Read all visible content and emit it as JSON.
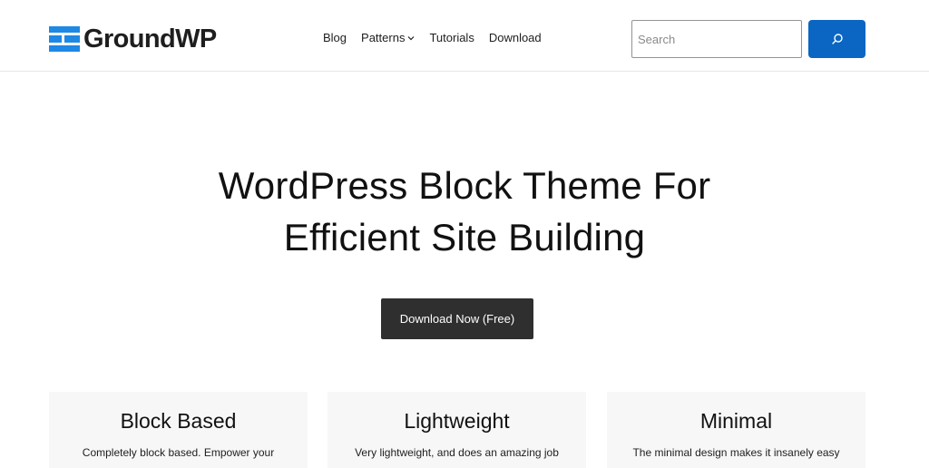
{
  "header": {
    "logo_text": "GroundWP",
    "nav": [
      {
        "label": "Blog",
        "has_dropdown": false
      },
      {
        "label": "Patterns",
        "has_dropdown": true
      },
      {
        "label": "Tutorials",
        "has_dropdown": false
      },
      {
        "label": "Download",
        "has_dropdown": false
      }
    ],
    "search": {
      "placeholder": "Search",
      "value": "",
      "button_icon": "search-icon"
    }
  },
  "hero": {
    "title_line1": "WordPress Block Theme For",
    "title_line2": "Efficient Site Building",
    "cta_label": "Download Now (Free)"
  },
  "features": [
    {
      "title": "Block Based",
      "text": "Completely block based. Empower your"
    },
    {
      "title": "Lightweight",
      "text": "Very lightweight, and does an amazing job"
    },
    {
      "title": "Minimal",
      "text": "The minimal design makes it insanely easy"
    }
  ],
  "colors": {
    "brand": "#1e88e5",
    "accent": "#0a66c2",
    "cta": "#2f2f2f",
    "card_bg": "#f7f7f7"
  }
}
